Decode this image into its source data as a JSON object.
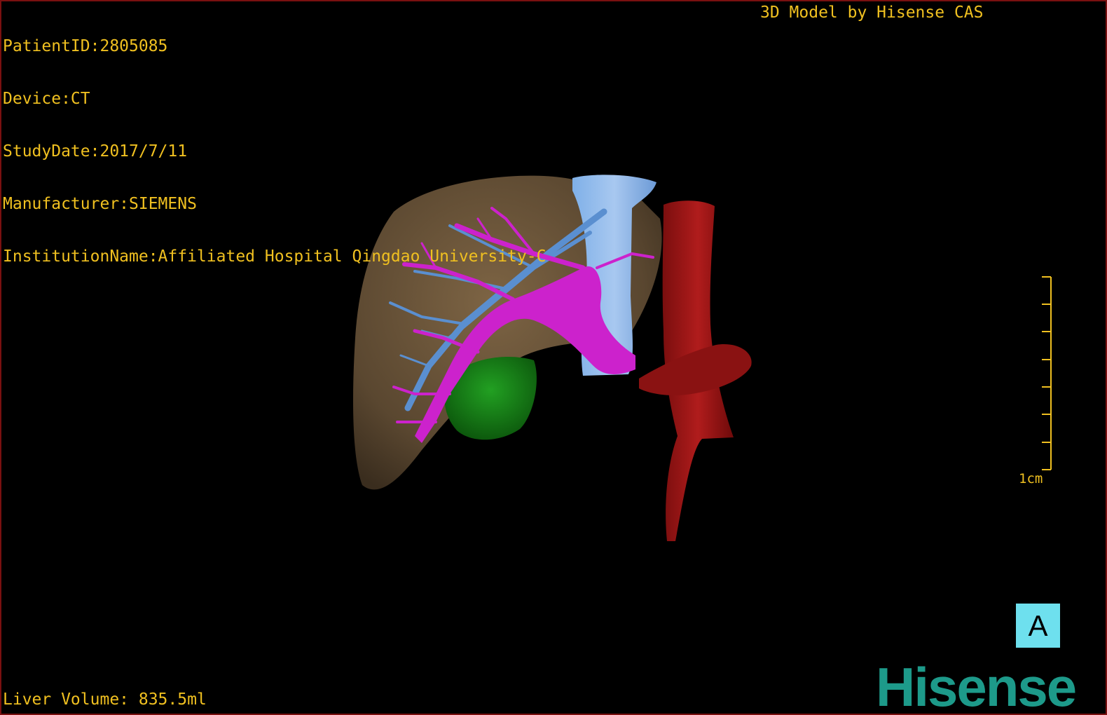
{
  "header": {
    "patient_id": "PatientID:2805085",
    "device": "Device:CT",
    "study_date": "StudyDate:2017/7/11",
    "manufacturer": "Manufacturer:SIEMENS",
    "institution": "InstitutionName:Affiliated Hospital Qingdao University-C"
  },
  "credit": "3D Model by Hisense CAS",
  "footer": {
    "liver_volume": "Liver Volume: 835.5ml"
  },
  "scale_bar": {
    "label": "1cm"
  },
  "view": {
    "orientation": "A"
  },
  "logo": {
    "text": "Hisense"
  },
  "colors": {
    "overlay_text": "#f0c020",
    "liver": "#8a6d4a",
    "portal_vein": "#cc22cc",
    "hepatic_vein": "#5a8fd0",
    "aorta": "#9a1515",
    "gallbladder": "#1a8a1a",
    "badge": "#6ee0ee",
    "logo": "#1d9a8a"
  }
}
